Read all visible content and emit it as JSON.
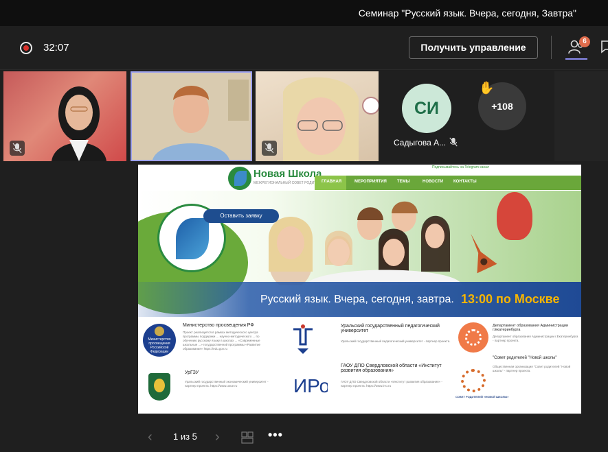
{
  "window": {
    "title": "Семинар \"Русский язык. Вчера, сегодня, Завтра\""
  },
  "toolbar": {
    "timer": "32:07",
    "take_control_label": "Получить управление",
    "participants_badge": "6"
  },
  "participants": {
    "si_initials": "СИ",
    "si_name": "Садыгова А...",
    "more_count": "+108"
  },
  "shared": {
    "telegram_link": "Подписывайтесь на Telegram канал",
    "logo_title": "Новая Школа",
    "logo_subtitle": "МЕЖРЕГИОНАЛЬНЫЙ СОВЕТ РОДИТЕЛЕЙ «НОВАЯ ШКОЛА»",
    "nav": [
      "ГЛАВНАЯ",
      "МЕРОПРИЯТИЯ",
      "ТЕМЫ",
      "НОВОСТИ",
      "КОНТАКТЫ"
    ],
    "apply_button": "Оставить заявку",
    "banner_text": "Русский язык. Вчера, сегодня, завтра.",
    "banner_time": "13:00 по Москве",
    "partners": {
      "ministry_title": "Министерство просвещения РФ",
      "ministry_emblem": "Министерство просвещения Российской Федерации",
      "ministry_desc": "Проект реализуется в рамках методического центра программы поддержки ... научно-методического ... по обучению русскому языку в школах ... «Современные школьные ...» государственной программы «Развитие образования» https://edu.gov.ru",
      "urgpu_title": "Уральский государственный педагогический университет",
      "urgpu_desc": "Уральский государственный педагогический университет - партнер проекта.",
      "dept_title": "Департамент образования Администрации г.Екатеринбурга",
      "dept_desc": "Департамент образования Администрации г.Екатеринбурга - партнер проекта.",
      "ugzu_title": "УрГЗУ",
      "ugzu_desc": "Уральский государственный экономический университет - партнер проекта. https://www.usue.ru",
      "irro_title": "ГАОУ ДПО Свердловской области «Институт развития образования»",
      "irro_desc": "ГАОУ ДПО Свердловской области «Институт развития образования» - партнер проекта. https://www.irro.ru",
      "council_title": "\"Совет родителей \"Новой школы\"",
      "council_desc": "Общественная организация \"Совет родителей \"Новой школы\" - партнер проекта.",
      "council_logo_text": "СОВЕТ РОДИТЕЛЕЙ «НОВОЙ ШКОЛЫ»"
    }
  },
  "pager": {
    "page_label": "1 из 5"
  },
  "colors": {
    "accent": "#8b8cf0",
    "badge": "#e06c4c",
    "record": "#d9322b"
  }
}
